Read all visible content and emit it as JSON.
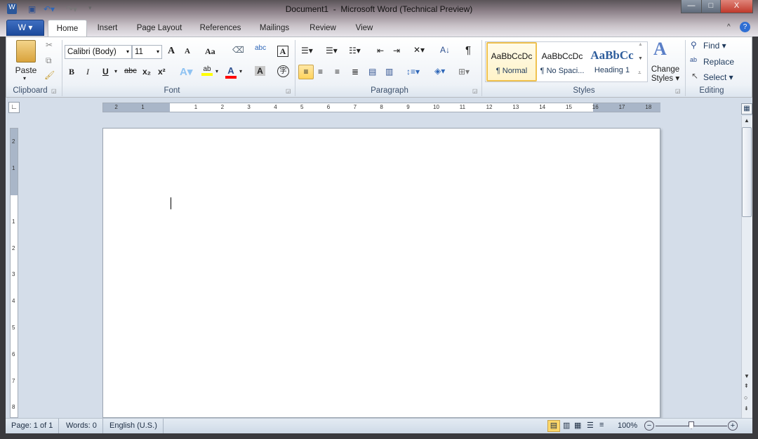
{
  "window": {
    "title": "Document1  -  Microsoft Word (Technical Preview)",
    "minimize": "—",
    "maximize": "□",
    "close": "X"
  },
  "file_tab": {
    "label": "W ▾"
  },
  "tabs": [
    {
      "label": "Home",
      "active": true
    },
    {
      "label": "Insert"
    },
    {
      "label": "Page Layout"
    },
    {
      "label": "References"
    },
    {
      "label": "Mailings"
    },
    {
      "label": "Review"
    },
    {
      "label": "View"
    }
  ],
  "ribbon": {
    "clipboard": {
      "label": "Clipboard",
      "paste": "Paste"
    },
    "font": {
      "label": "Font",
      "font_name": "Calibri (Body)",
      "font_size": "11",
      "bold": "B",
      "italic": "I",
      "underline": "U",
      "strike": "abc",
      "subscript": "x₂",
      "superscript": "x²",
      "change_case": "Aa",
      "grow": "A",
      "shrink": "A",
      "font_color": "A",
      "char_shading": "A",
      "enclose": "字"
    },
    "paragraph": {
      "label": "Paragraph",
      "pilcrow": "¶"
    },
    "styles": {
      "label": "Styles",
      "items": [
        {
          "preview": "AaBbCcDc",
          "name": "¶ Normal",
          "selected": true
        },
        {
          "preview": "AaBbCcDc",
          "name": "¶ No Spaci..."
        },
        {
          "preview": "AaBbCc",
          "name": "Heading 1"
        }
      ],
      "change_styles": "Change Styles ▾"
    },
    "editing": {
      "label": "Editing",
      "find": "Find ▾",
      "replace": "Replace",
      "select": "Select ▾"
    }
  },
  "ruler": {
    "h_left": [
      "2",
      "1"
    ],
    "h_right": [
      "1",
      "2",
      "3",
      "4",
      "5",
      "6",
      "7",
      "8",
      "9",
      "10",
      "11",
      "12",
      "13",
      "14",
      "15",
      "16",
      "17",
      "18"
    ],
    "v_top": [
      "2",
      "1"
    ],
    "v_main": [
      "1",
      "2",
      "3",
      "4",
      "5",
      "6",
      "7",
      "8"
    ]
  },
  "status": {
    "page": "Page: 1 of 1",
    "words": "Words: 0",
    "language": "English (U.S.)",
    "zoom": "100%",
    "zoom_percent": 100
  },
  "colors": {
    "accent": "#2b579a",
    "highlight": "#ffff00",
    "font_color": "#ff0000",
    "selected": "#ffd86a"
  }
}
